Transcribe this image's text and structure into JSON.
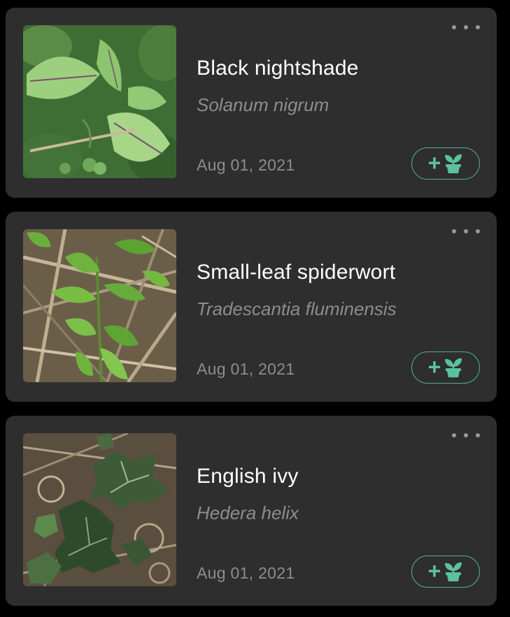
{
  "colors": {
    "background": "#000000",
    "card": "#2e2e2f",
    "accent": "#5cc29b",
    "secondary_text": "#8d8d90",
    "primary_text": "#ffffff"
  },
  "plants": [
    {
      "common_name": "Black nightshade",
      "scientific_name": "Solanum nigrum",
      "date": "Aug 01, 2021",
      "photo": "black-nightshade-photo",
      "more_icon": "more-horizontal-icon",
      "add_icon": "add-to-garden-icon"
    },
    {
      "common_name": "Small-leaf spiderwort",
      "scientific_name": "Tradescantia fluminensis",
      "date": "Aug 01, 2021",
      "photo": "small-leaf-spiderwort-photo",
      "more_icon": "more-horizontal-icon",
      "add_icon": "add-to-garden-icon"
    },
    {
      "common_name": "English ivy",
      "scientific_name": "Hedera helix",
      "date": "Aug 01, 2021",
      "photo": "english-ivy-photo",
      "more_icon": "more-horizontal-icon",
      "add_icon": "add-to-garden-icon"
    }
  ]
}
